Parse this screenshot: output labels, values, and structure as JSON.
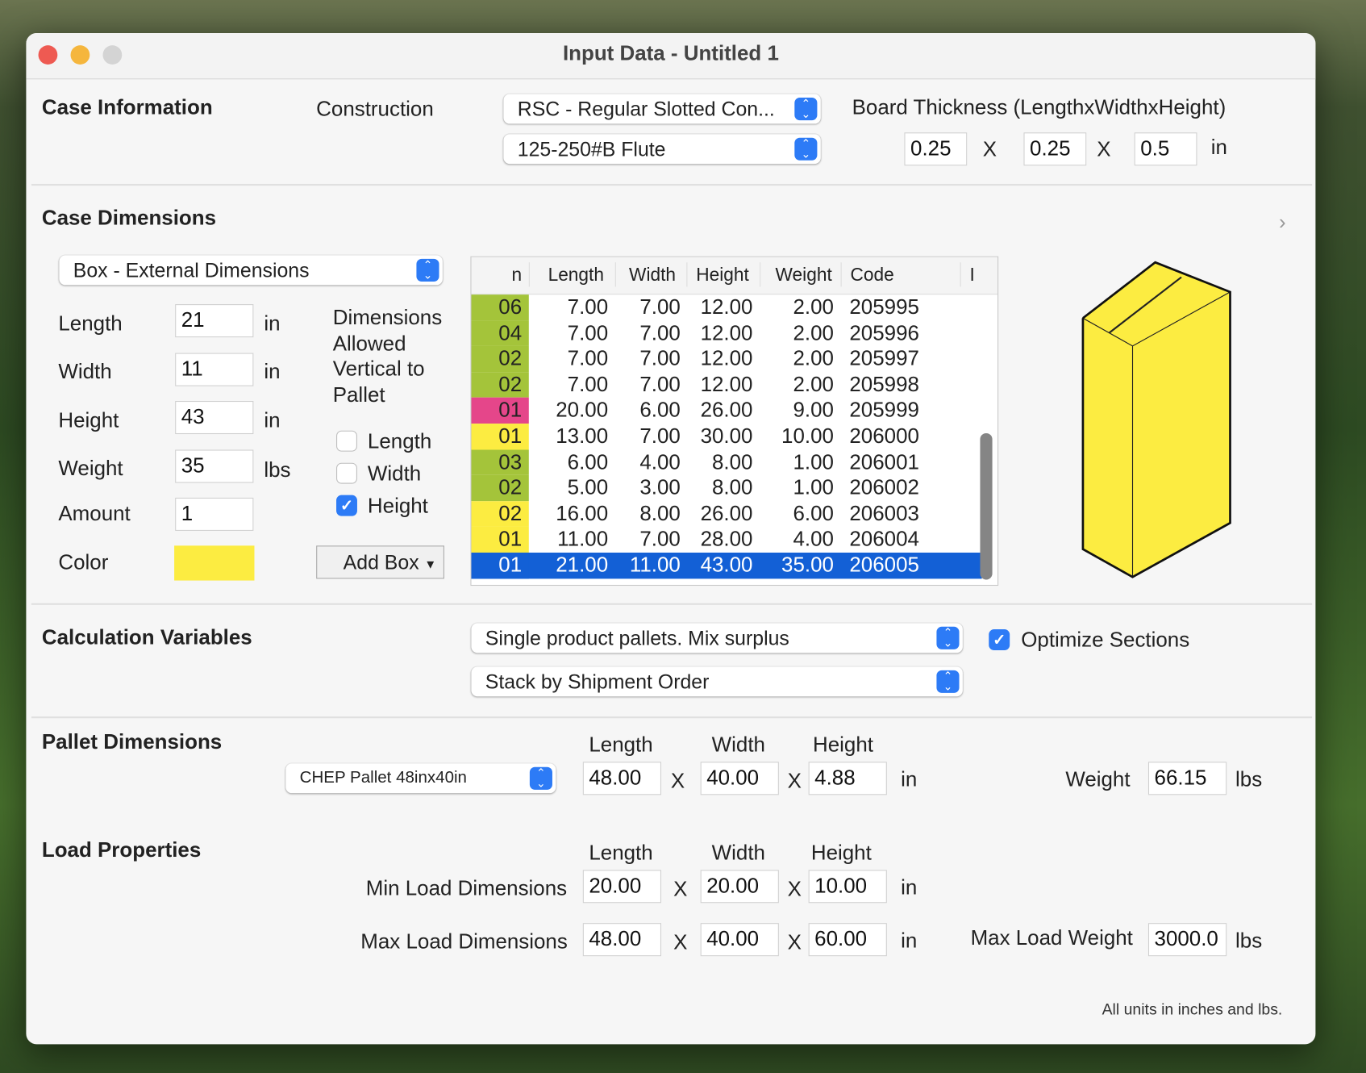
{
  "window": {
    "title": "Input Data - Untitled 1"
  },
  "case_information": {
    "heading": "Case Information",
    "construction_label": "Construction",
    "construction_value": "RSC - Regular Slotted Con...",
    "flute_value": "125-250#B Flute",
    "board_thickness_label": "Board Thickness (LengthxWidthxHeight)",
    "thickness": [
      "0.25",
      "0.25",
      "0.5"
    ],
    "x": "X",
    "unit": "in"
  },
  "case_dimensions": {
    "heading": "Case Dimensions",
    "mode": "Box - External Dimensions",
    "fields": [
      {
        "label": "Length",
        "value": "21",
        "unit": "in"
      },
      {
        "label": "Width",
        "value": "11",
        "unit": "in"
      },
      {
        "label": "Height",
        "value": "43",
        "unit": "in"
      },
      {
        "label": "Weight",
        "value": "35",
        "unit": "lbs"
      },
      {
        "label": "Amount",
        "value": "1",
        "unit": ""
      }
    ],
    "color_label": "Color",
    "color": "#fcec41",
    "vertical_label": "Dimensions Allowed Vertical to Pallet",
    "vertical": [
      {
        "label": "Length",
        "checked": false
      },
      {
        "label": "Width",
        "checked": false
      },
      {
        "label": "Height",
        "checked": true
      }
    ],
    "add_box": "Add Box",
    "table": {
      "columns": [
        "n",
        "Length",
        "Width",
        "Height",
        "Weight",
        "Code",
        "I"
      ],
      "rows": [
        {
          "n": "06",
          "length": "7.00",
          "width": "7.00",
          "height": "12.00",
          "weight": "2.00",
          "code": "205995",
          "color": "#a4c43a"
        },
        {
          "n": "04",
          "length": "7.00",
          "width": "7.00",
          "height": "12.00",
          "weight": "2.00",
          "code": "205996",
          "color": "#a4c43a"
        },
        {
          "n": "02",
          "length": "7.00",
          "width": "7.00",
          "height": "12.00",
          "weight": "2.00",
          "code": "205997",
          "color": "#a4c43a"
        },
        {
          "n": "02",
          "length": "7.00",
          "width": "7.00",
          "height": "12.00",
          "weight": "2.00",
          "code": "205998",
          "color": "#a4c43a"
        },
        {
          "n": "01",
          "length": "20.00",
          "width": "6.00",
          "height": "26.00",
          "weight": "9.00",
          "code": "205999",
          "color": "#e5468a"
        },
        {
          "n": "01",
          "length": "13.00",
          "width": "7.00",
          "height": "30.00",
          "weight": "10.00",
          "code": "206000",
          "color": "#fcec41"
        },
        {
          "n": "03",
          "length": "6.00",
          "width": "4.00",
          "height": "8.00",
          "weight": "1.00",
          "code": "206001",
          "color": "#a4c43a"
        },
        {
          "n": "02",
          "length": "5.00",
          "width": "3.00",
          "height": "8.00",
          "weight": "1.00",
          "code": "206002",
          "color": "#a4c43a"
        },
        {
          "n": "02",
          "length": "16.00",
          "width": "8.00",
          "height": "26.00",
          "weight": "6.00",
          "code": "206003",
          "color": "#fcec41"
        },
        {
          "n": "01",
          "length": "11.00",
          "width": "7.00",
          "height": "28.00",
          "weight": "4.00",
          "code": "206004",
          "color": "#fcec41"
        },
        {
          "n": "01",
          "length": "21.00",
          "width": "11.00",
          "height": "43.00",
          "weight": "35.00",
          "code": "206005",
          "color": "#1360d6",
          "selected": true
        }
      ]
    }
  },
  "calculation": {
    "heading": "Calculation Variables",
    "mode": "Single product pallets. Mix surplus",
    "stack": "Stack by Shipment Order",
    "optimize_label": "Optimize Sections",
    "optimize": true
  },
  "pallet": {
    "heading": "Pallet Dimensions",
    "type": "CHEP Pallet 48inx40in",
    "labels": [
      "Length",
      "Width",
      "Height"
    ],
    "values": [
      "48.00",
      "40.00",
      "4.88"
    ],
    "unit": "in",
    "weight_label": "Weight",
    "weight": "66.15",
    "weight_unit": "lbs"
  },
  "load": {
    "heading": "Load Properties",
    "labels": [
      "Length",
      "Width",
      "Height"
    ],
    "min_label": "Min Load Dimensions",
    "min": [
      "20.00",
      "20.00",
      "10.00"
    ],
    "max_label": "Max Load Dimensions",
    "max": [
      "48.00",
      "40.00",
      "60.00"
    ],
    "unit": "in",
    "max_weight_label": "Max Load Weight",
    "max_weight": "3000.0",
    "weight_unit": "lbs"
  },
  "footer": "All units in inches and lbs."
}
